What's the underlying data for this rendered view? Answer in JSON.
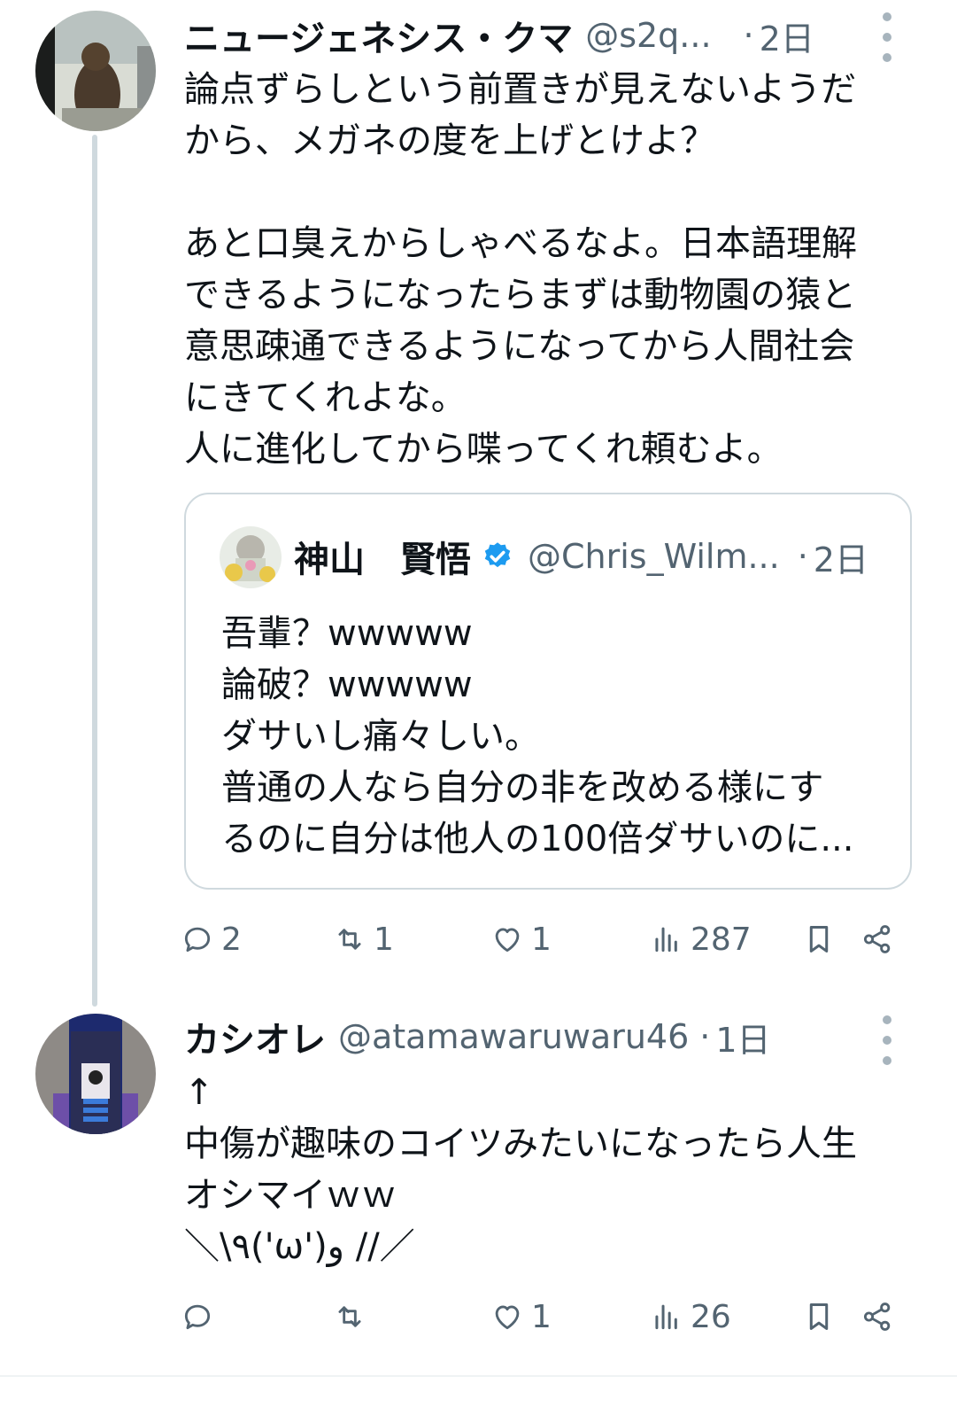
{
  "post1": {
    "name": "ニュージェネシス・クマ",
    "handle": "@s2q...",
    "time": "2日",
    "text": "論点ずらしという前置きが見えないようだ\nから、メガネの度を上げとけよ？\n\nあと口臭えからしゃべるなよ。日本語理解\nできるようになったらまずは動物園の猿と\n意思疎通できるようになってから人間社会\nにきてくれよな。\n人に進化してから喋ってくれ頼むよ。",
    "quote": {
      "name": "神山　賢悟",
      "handle": "@Chris_Wilm...",
      "time": "2日",
      "text": "吾輩？wwwww\n論破？wwwww\nダサいし痛々しい。\n普通の人なら自分の非を改める様にす\nるのに自分は他人の100倍ダサいのに..."
    },
    "actions": {
      "replies": "2",
      "retweets": "1",
      "likes": "1",
      "views": "287"
    }
  },
  "post2": {
    "name": "カシオレ",
    "handle": "@atamawaruwaru46",
    "time": "1日",
    "text": "↑\n中傷が趣味のコイツみたいになったら人生\nオシマイｗｗ\n＼\\٩('ω')و //／",
    "actions": {
      "replies": "",
      "retweets": "",
      "likes": "1",
      "views": "26"
    }
  },
  "colors": {
    "text": "#0f1419",
    "secondary": "#536471",
    "border": "#cfd9de",
    "verified": "#1d9bf0"
  },
  "icons": [
    "reply-icon",
    "retweet-icon",
    "like-icon",
    "views-icon",
    "bookmark-icon",
    "share-icon",
    "more-icon",
    "verified-badge-icon"
  ]
}
